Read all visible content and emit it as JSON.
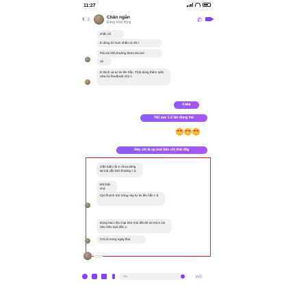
{
  "status_bar": {
    "time": "11:27"
  },
  "header": {
    "back_count": "2",
    "contact_name": "Chân ngắn",
    "contact_status": "Đang hoạt động"
  },
  "messages": [
    {
      "id": "m1",
      "text": "chắc cả"
    },
    {
      "id": "m2",
      "text": "E dùng từ hum nhận ck đó c"
    },
    {
      "id": "m3",
      "text": "Pải nói khô thoáng thơm tho lun"
    },
    {
      "id": "m4",
      "text": "cả"
    },
    {
      "id": "m5",
      "text": "E thích và tự tin lên hẳn. Tính dùng thêm tuần nữa rùi feedback cho c"
    },
    {
      "id": "m6",
      "text": "Kaka"
    },
    {
      "id": "m7",
      "text": "Hết sau 1-2 lần dùng mà"
    },
    {
      "id": "m8",
      "text": "Đây chỉ là sp test bên chị thôi đây"
    },
    {
      "id": "m9",
      "text": "Gần tuần rùi e chưa dùng lại mà vẫn khô thoáng c à"
    },
    {
      "id": "m10",
      "text": "Đã thật chứ"
    },
    {
      "id": "m11",
      "text": "Cpi đi xinh trời nóng này tự tin lên hẳn c à"
    },
    {
      "id": "m12",
      "text": "Dùng bao nhiu loại khử mùi đắt đỏ rùi mà k cái nào hiệu quả đâu c."
    },
    {
      "id": "m13",
      "text": "Chỉ ck trong ngày thui"
    }
  ],
  "composer": {
    "placeholder": "Aa"
  },
  "icons": {
    "back": "chevron-left-icon",
    "call": "phone-icon",
    "video": "video-icon",
    "plus": "plus-circle-icon",
    "camera": "camera-icon",
    "image": "image-icon",
    "mic": "mic-icon",
    "emoji": "smile-icon",
    "like": "thumbs-up-icon"
  },
  "colors": {
    "accent": "#8a3ffc",
    "highlight": "#e11d2e",
    "bubble_in": "#efeff1"
  }
}
